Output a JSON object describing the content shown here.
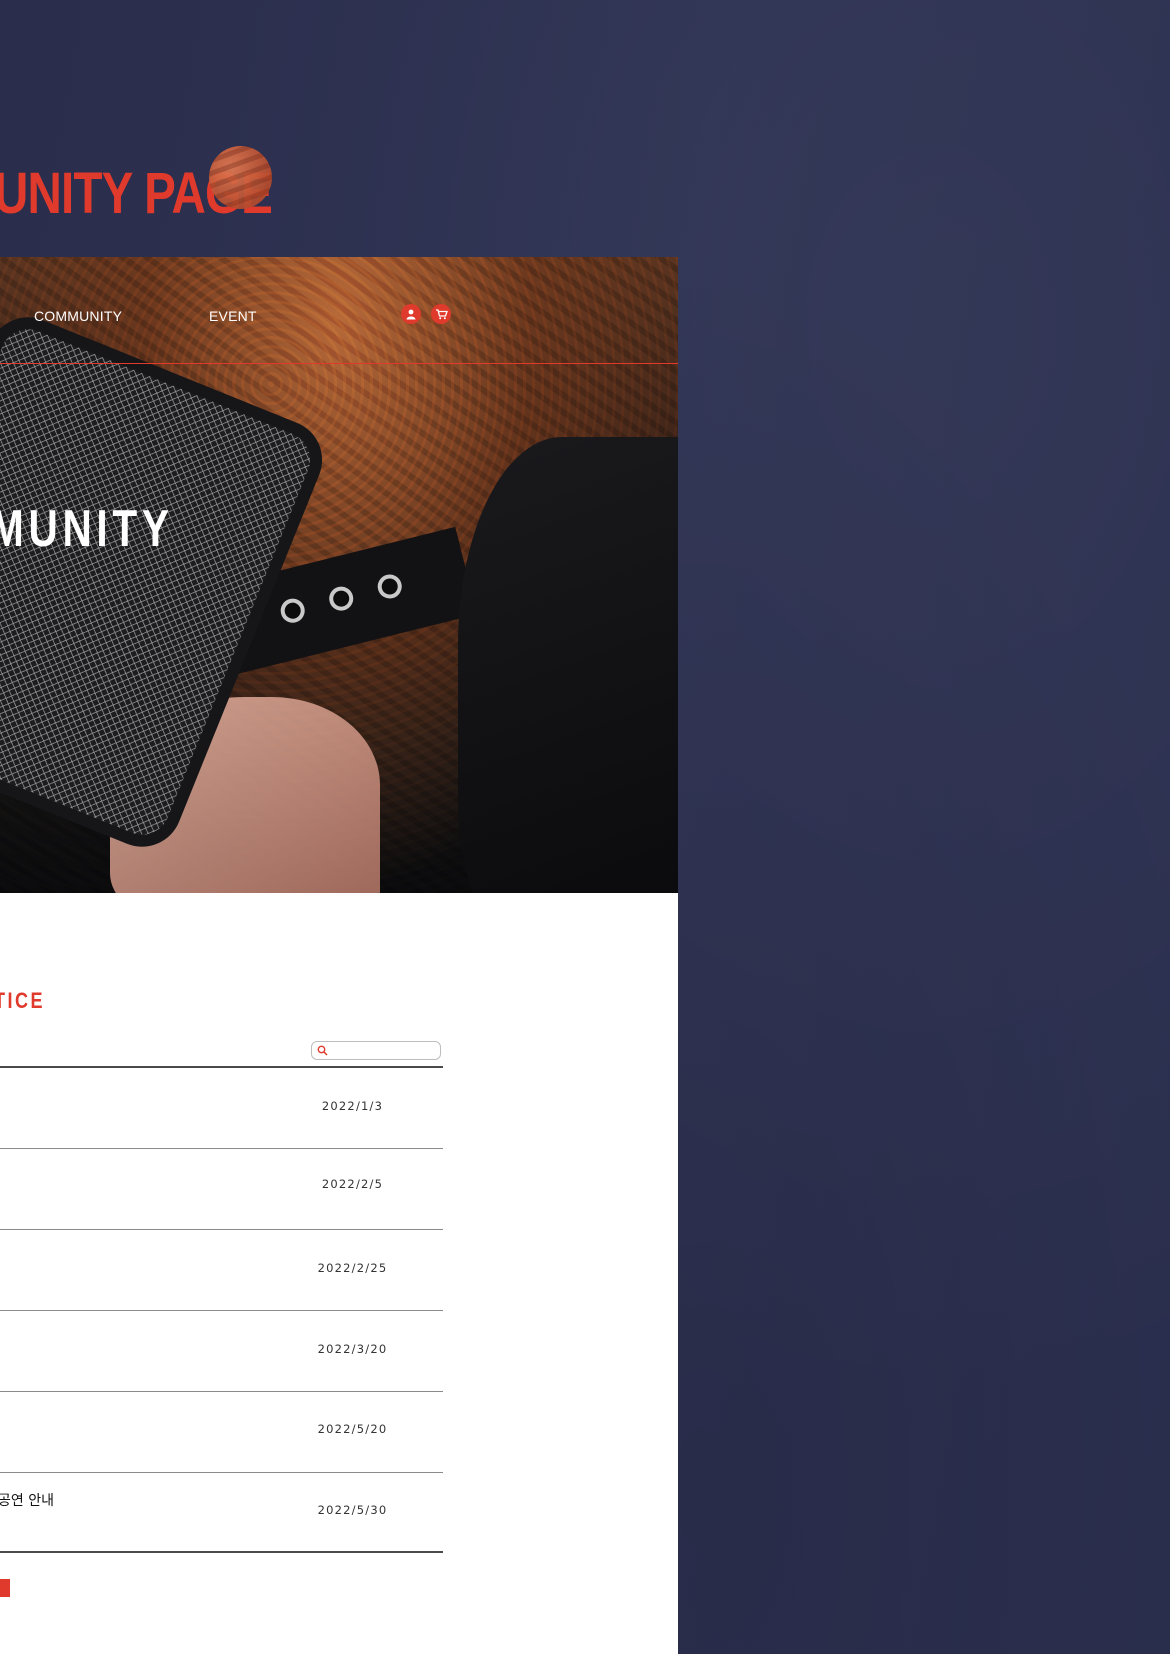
{
  "header": {
    "page_title": "UNITY PAGE"
  },
  "nav": {
    "items": [
      {
        "label": "COMMUNITY"
      },
      {
        "label": "EVENT"
      }
    ],
    "icons": [
      "user-icon",
      "cart-icon"
    ]
  },
  "hero": {
    "title": "MUNITY"
  },
  "notice": {
    "section_title": "TICE",
    "search": {
      "placeholder": "",
      "value": ""
    },
    "rows": [
      {
        "title": "",
        "date": "2022/1/3"
      },
      {
        "title": "",
        "date": "2022/2/5"
      },
      {
        "title": "",
        "date": "2022/2/25"
      },
      {
        "title": "",
        "date": "2022/3/20"
      },
      {
        "title": "",
        "date": "2022/5/20"
      },
      {
        "title": "공연 안내",
        "date": "2022/5/30"
      }
    ],
    "write_button": ""
  },
  "colors": {
    "background": "#2c3050",
    "accent": "#e03a2c",
    "panel": "#ffffff"
  }
}
